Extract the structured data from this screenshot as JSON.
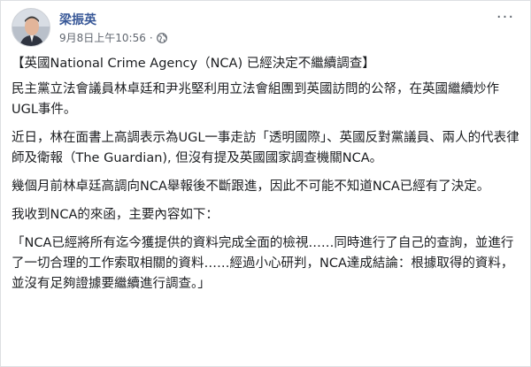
{
  "post": {
    "author": "梁振英",
    "timestamp": "9月8日上午10:56",
    "separator": "·",
    "privacy_icon": "globe-icon",
    "more_icon": "more-options-icon",
    "more_label": "···"
  },
  "content": {
    "title": "【英國National Crime Agency（NCA) 已經決定不繼續調查】",
    "paragraphs": [
      "民主黨立法會議員林卓廷和尹兆堅利用立法會組團到英國訪問的公帑，在英國繼續炒作UGL事件。",
      "近日，林在面書上高調表示為UGL一事走訪「透明國際」、英國反對黨議員、兩人的代表律師及衛報（The Guardian), 但沒有提及英國國家調查機關NCA。",
      "幾個月前林卓廷高調向NCA舉報後不斷跟進，因此不可能不知道NCA已經有了決定。",
      "我收到NCA的來函，主要內容如下："
    ],
    "quote": "「NCA已經將所有迄今獲提供的資料完成全面的檢視……同時進行了自己的查詢，並進行了一切合理的工作索取相關的資料……經過小心研判，NCA達成結論：根據取得的資料，並沒有足夠證據要繼續進行調查。」"
  },
  "colors": {
    "author": "#385898",
    "meta": "#616770",
    "text": "#1c1e21"
  }
}
